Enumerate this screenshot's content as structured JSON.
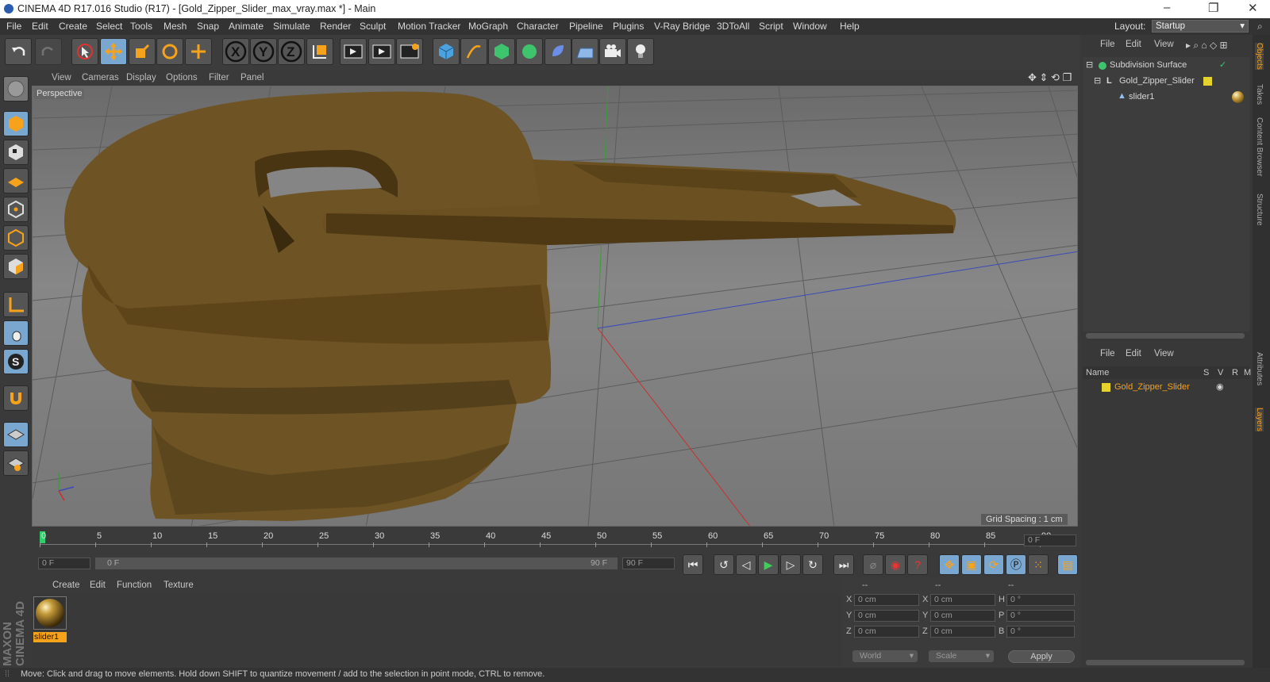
{
  "window": {
    "title": "CINEMA 4D R17.016 Studio (R17) - [Gold_Zipper_Slider_max_vray.max *] - Main"
  },
  "menu": [
    "File",
    "Edit",
    "Create",
    "Select",
    "Tools",
    "Mesh",
    "Snap",
    "Animate",
    "Simulate",
    "Render",
    "Sculpt",
    "Motion Tracker",
    "MoGraph",
    "Character",
    "Pipeline",
    "Plugins",
    "V-Ray Bridge",
    "3DToAll",
    "Script",
    "Window",
    "Help"
  ],
  "layout": {
    "label": "Layout:",
    "value": "Startup"
  },
  "toolbar_labels": {
    "x": "X",
    "y": "Y",
    "z": "Z"
  },
  "viewport": {
    "menu": [
      "View",
      "Cameras",
      "Display",
      "Options",
      "Filter",
      "Panel"
    ],
    "label": "Perspective",
    "grid": "Grid Spacing : 1 cm"
  },
  "timeline": {
    "ticks": [
      "0",
      "5",
      "10",
      "15",
      "20",
      "25",
      "30",
      "35",
      "40",
      "45",
      "50",
      "55",
      "60",
      "65",
      "70",
      "75",
      "80",
      "85",
      "90"
    ],
    "current": "0 F",
    "start": "0 F",
    "slider_start": "0 F",
    "slider_end": "90 F",
    "end": "90 F"
  },
  "material": {
    "menu": [
      "Create",
      "Edit",
      "Function",
      "Texture"
    ],
    "item": "slider1"
  },
  "coords": {
    "hdr": [
      "--",
      "--",
      "--"
    ],
    "x1": "0 cm",
    "y1": "0 cm",
    "z1": "0 cm",
    "x2": "0 cm",
    "y2": "0 cm",
    "z2": "0 cm",
    "h": "0 °",
    "p": "0 °",
    "b": "0 °",
    "world": "World",
    "scale": "Scale",
    "apply": "Apply",
    "labels": {
      "x": "X",
      "y": "Y",
      "z": "Z",
      "h": "H",
      "p": "P",
      "b": "B"
    }
  },
  "objects": {
    "menu": [
      "File",
      "Edit",
      "View"
    ],
    "items": [
      "Subdivision Surface",
      "Gold_Zipper_Slider",
      "slider1"
    ]
  },
  "layers": {
    "menu": [
      "File",
      "Edit",
      "View"
    ],
    "cols": {
      "name": "Name",
      "s": "S",
      "v": "V",
      "r": "R",
      "m": "M"
    },
    "item": "Gold_Zipper_Slider"
  },
  "side_tabs": [
    "Objects",
    "Takes",
    "Content Browser",
    "Structure",
    "Attributes",
    "Layers"
  ],
  "brand": "MAXON CINEMA 4D",
  "status": "Move: Click and drag to move elements. Hold down SHIFT to quantize movement / add to the selection in point mode, CTRL to remove."
}
